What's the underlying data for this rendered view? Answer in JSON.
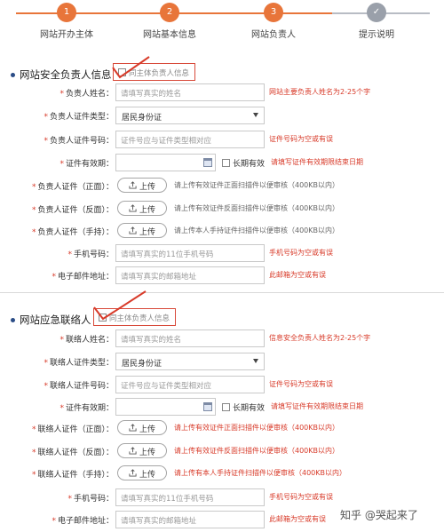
{
  "steps": [
    {
      "number": "1",
      "label": "网站开办主体"
    },
    {
      "number": "2",
      "label": "网站基本信息"
    },
    {
      "number": "3",
      "label": "网站负责人"
    },
    {
      "number": "",
      "label": "提示说明"
    }
  ],
  "colors": {
    "accent": "#e8753a",
    "error": "#d83b2a",
    "inactive": "#9aa0aa"
  },
  "section1": {
    "title": "网站安全负责人信息",
    "same_as_label": "同主体负责人信息",
    "rows": {
      "name": {
        "label": "负责人姓名：",
        "placeholder": "请填写真实的姓名",
        "hint": "网站主要负责人姓名为2-25个字"
      },
      "id_type": {
        "label": "负责人证件类型：",
        "value": "居民身份证"
      },
      "id_number": {
        "label": "负责人证件号码：",
        "placeholder": "证件号应与证件类型相对应",
        "hint": "证件号码为空或有误"
      },
      "validity": {
        "label": "证件有效期：",
        "long_term": "长期有效",
        "hint": "请填写证件有效期限结束日期"
      },
      "front": {
        "label": "负责人证件（正面）：",
        "button": "上传",
        "hint": "请上传有效证件正面扫描件以便审核（400KB以内）"
      },
      "back": {
        "label": "负责人证件（反面）：",
        "button": "上传",
        "hint": "请上传有效证件反面扫描件以便审核（400KB以内）"
      },
      "hold": {
        "label": "负责人证件（手持）：",
        "button": "上传",
        "hint": "请上传本人手持证件扫描件以便审核（400KB以内）"
      },
      "phone": {
        "label": "手机号码：",
        "placeholder": "请填写真实的11位手机号码",
        "hint": "手机号码为空或有误"
      },
      "email": {
        "label": "电子邮件地址：",
        "placeholder": "请填写真实的邮箱地址",
        "hint": "此邮箱为空或有误"
      }
    }
  },
  "section2": {
    "title": "网站应急联络人",
    "same_as_label": "同主体负责人信息",
    "rows": {
      "name": {
        "label": "联络人姓名：",
        "placeholder": "请填写真实的姓名",
        "hint": "信息安全负责人姓名为2-25个字"
      },
      "id_type": {
        "label": "联络人证件类型：",
        "value": "居民身份证"
      },
      "id_number": {
        "label": "联络人证件号码：",
        "placeholder": "证件号应与证件类型相对应",
        "hint": "证件号码为空或有误"
      },
      "validity": {
        "label": "证件有效期：",
        "long_term": "长期有效",
        "hint": "请填写证件有效期限结束日期"
      },
      "front": {
        "label": "联络人证件（正面）：",
        "button": "上传",
        "hint": "请上传有效证件正面扫描件以便审核（400KB以内）"
      },
      "back": {
        "label": "联络人证件（反面）：",
        "button": "上传",
        "hint": "请上传有效证件反面扫描件以便审核（400KB以内）"
      },
      "hold": {
        "label": "联络人证件（手持）：",
        "button": "上传",
        "hint": "请上传有本人手持证件扫描件以便审核（400KB以内）"
      },
      "phone": {
        "label": "手机号码：",
        "placeholder": "请填写真实的11位手机号码",
        "hint": "手机号码为空或有误"
      },
      "email": {
        "label": "电子邮件地址：",
        "placeholder": "请填写真实的邮箱地址",
        "hint": "此邮箱为空或有误"
      }
    }
  },
  "watermark": "知乎 @哭起来了"
}
